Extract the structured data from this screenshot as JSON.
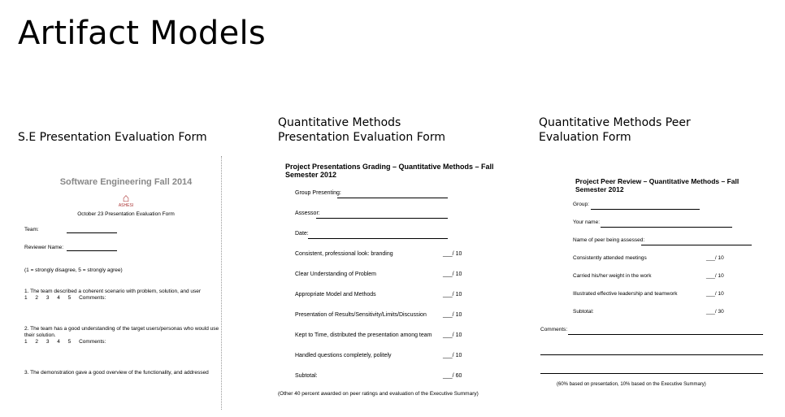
{
  "slide": {
    "title": "Artifact Models"
  },
  "captions": [
    {
      "lines": [
        "S.E Presentation Evaluation Form"
      ]
    },
    {
      "lines": [
        "Quantitative Methods",
        "Presentation Evaluation Form"
      ]
    },
    {
      "lines": [
        "Quantitative Methods Peer",
        "Evaluation Form"
      ]
    }
  ],
  "form1": {
    "header": "Software Engineering Fall 2014",
    "seal_text": "ASHESI",
    "subtitle": "October 23 Presentation Evaluation Form",
    "team_label": "Team:",
    "reviewer_label": "Reviewer Name:",
    "scale_note": "(1 = strongly disagree, 5 = strongly agree)",
    "q1": "1. The team described a coherent scenario with problem, solution, and user",
    "q2": "2. The team has a good understanding of the target users/personas who would use their solution.",
    "q3": "3. The demonstration gave a good overview of the functionality, and addressed",
    "scale": "1 2 3 4 5 Comments:"
  },
  "form2": {
    "header": "Project Presentations Grading – Quantitative Methods – Fall Semester 2012",
    "fields": [
      "Group Presenting:",
      "Assessor:",
      "Date:"
    ],
    "criteria": [
      {
        "label": "Consistent, professional look: branding",
        "score": "___/ 10"
      },
      {
        "label": "Clear Understanding of Problem",
        "score": "___/ 10"
      },
      {
        "label": "Appropriate Model and Methods",
        "score": "___/ 10"
      },
      {
        "label": "Presentation of Results/Sensitivity/Limits/Discussion",
        "score": "___/ 10"
      },
      {
        "label": "Kept to Time, distributed the presentation among team",
        "score": "___/ 10"
      },
      {
        "label": "Handled questions completely, politely",
        "score": "___/ 10"
      },
      {
        "label": "Subtotal:",
        "score": "___/ 60"
      }
    ],
    "note": "(Other 40 percent awarded on peer ratings and evaluation of the Executive Summary)"
  },
  "form3": {
    "header": "Project Peer Review – Quantitative Methods – Fall Semester 2012",
    "fields": [
      "Group:",
      "Your name:",
      "Name of peer being assessed:"
    ],
    "criteria": [
      {
        "label": "Consistently attended meetings",
        "score": "___/ 10"
      },
      {
        "label": "Carried his/her weight in the work",
        "score": "___/ 10"
      },
      {
        "label": "Illustrated effective leadership and teamwork",
        "score": "___/ 10"
      },
      {
        "label": "Subtotal:",
        "score": "___/ 30"
      }
    ],
    "comments_label": "Comments:",
    "note": "(60% based on presentation, 10% based on the Executive Summary)"
  }
}
